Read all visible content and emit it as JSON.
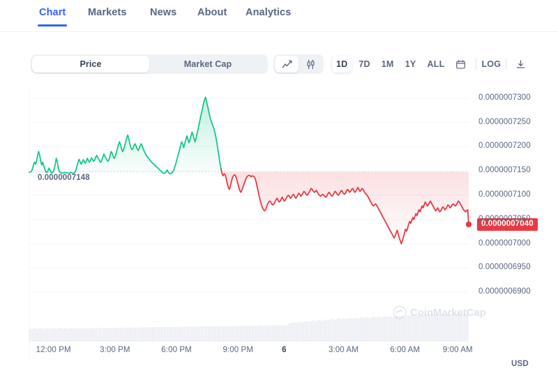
{
  "nav": {
    "tabs": [
      {
        "label": "Chart",
        "active": true
      },
      {
        "label": "Markets",
        "active": false
      },
      {
        "label": "News",
        "active": false
      },
      {
        "label": "About",
        "active": false
      },
      {
        "label": "Analytics",
        "active": false
      }
    ]
  },
  "toolbar": {
    "metric_toggle": [
      {
        "label": "Price",
        "active": true
      },
      {
        "label": "Market Cap",
        "active": false
      }
    ],
    "chart_types": [
      {
        "icon": "line-chart-icon",
        "active": true
      },
      {
        "icon": "candlestick-chart-icon",
        "active": false
      }
    ],
    "ranges": [
      {
        "label": "1D",
        "active": true
      },
      {
        "label": "7D",
        "active": false
      },
      {
        "label": "1M",
        "active": false
      },
      {
        "label": "1Y",
        "active": false
      },
      {
        "label": "ALL",
        "active": false
      }
    ],
    "calendar_icon": "calendar-icon",
    "log_label": "LOG",
    "download_icon": "download-icon"
  },
  "chart_data": {
    "type": "line",
    "title": "",
    "xlabel": "",
    "ylabel": "",
    "currency": "USD",
    "open_price_label": "0.0000007148",
    "open_price": 7.148e-07,
    "current_price_label": "0.0000007040",
    "current_price": 7.04e-07,
    "ylim": [
      6.8875e-07,
      7.3125e-07
    ],
    "y_ticks": [
      "0.0000007300",
      "0.0000007250",
      "0.0000007200",
      "0.0000007150",
      "0.0000007100",
      "0.0000007050",
      "0.0000007000",
      "0.0000006950",
      "0.0000006900"
    ],
    "y_tick_values": [
      7.3e-07,
      7.25e-07,
      7.2e-07,
      7.15e-07,
      7.1e-07,
      7.05e-07,
      7e-07,
      6.95e-07,
      6.9e-07
    ],
    "x_ticks": [
      "12:00 PM",
      "3:00 PM",
      "6:00 PM",
      "9:00 PM",
      "6",
      "3:00 AM",
      "6:00 AM",
      "9:00 AM"
    ],
    "x_tick_positions": [
      0.055,
      0.195,
      0.335,
      0.475,
      0.58,
      0.715,
      0.855,
      0.975
    ],
    "grid": true,
    "legend": false,
    "colors": {
      "up": "#16C784",
      "down": "#EA3943",
      "brand_blue": "#3861FB",
      "axis_text": "#58667E",
      "grid": "#F3F5F8",
      "volume": "#CFD6E4"
    },
    "series": [
      {
        "name": "Price",
        "values": [
          7.1475e-07,
          7.1478e-07,
          7.149e-07,
          7.154e-07,
          7.162e-07,
          7.168e-07,
          7.164e-07,
          7.17e-07,
          7.182e-07,
          7.19e-07,
          7.183e-07,
          7.17e-07,
          7.162e-07,
          7.168e-07,
          7.161e-07,
          7.154e-07,
          7.148e-07,
          7.147e-07,
          7.15e-07,
          7.156e-07,
          7.152e-07,
          7.147e-07,
          7.146e-07,
          7.148e-07,
          7.154e-07,
          7.164e-07,
          7.176e-07,
          7.169e-07,
          7.156e-07,
          7.149e-07,
          7.147e-07,
          7.146e-07,
          7.1455e-07,
          7.1462e-07,
          7.147e-07,
          7.1465e-07,
          7.146e-07,
          7.1455e-07,
          7.145e-07,
          7.1455e-07,
          7.147e-07,
          7.146e-07,
          7.145e-07,
          7.1455e-07,
          7.147e-07,
          7.152e-07,
          7.16e-07,
          7.168e-07,
          7.174e-07,
          7.169e-07,
          7.164e-07,
          7.168e-07,
          7.173e-07,
          7.17e-07,
          7.166e-07,
          7.17e-07,
          7.176e-07,
          7.172e-07,
          7.168e-07,
          7.171e-07,
          7.177e-07,
          7.174e-07,
          7.17e-07,
          7.172e-07,
          7.178e-07,
          7.182e-07,
          7.178e-07,
          7.174e-07,
          7.17e-07,
          7.168e-07,
          7.172e-07,
          7.179e-07,
          7.185e-07,
          7.18e-07,
          7.176e-07,
          7.172e-07,
          7.17e-07,
          7.174e-07,
          7.182e-07,
          7.19e-07,
          7.186e-07,
          7.18e-07,
          7.176e-07,
          7.18e-07,
          7.188e-07,
          7.196e-07,
          7.204e-07,
          7.21e-07,
          7.204e-07,
          7.196e-07,
          7.19e-07,
          7.194e-07,
          7.202e-07,
          7.21e-07,
          7.218e-07,
          7.224e-07,
          7.216e-07,
          7.206e-07,
          7.198e-07,
          7.194e-07,
          7.196e-07,
          7.202e-07,
          7.206e-07,
          7.202e-07,
          7.196e-07,
          7.192e-07,
          7.196e-07,
          7.202e-07,
          7.206e-07,
          7.201e-07,
          7.195e-07,
          7.19e-07,
          7.186e-07,
          7.182e-07,
          7.179e-07,
          7.176e-07,
          7.174e-07,
          7.171e-07,
          7.168e-07,
          7.166e-07,
          7.164e-07,
          7.162e-07,
          7.16e-07,
          7.158e-07,
          7.156e-07,
          7.154e-07,
          7.152e-07,
          7.15e-07,
          7.148e-07,
          7.146e-07,
          7.145e-07,
          7.146e-07,
          7.148e-07,
          7.152e-07,
          7.148e-07,
          7.145e-07,
          7.144e-07,
          7.145e-07,
          7.147e-07,
          7.15e-07,
          7.156e-07,
          7.162e-07,
          7.17e-07,
          7.178e-07,
          7.186e-07,
          7.194e-07,
          7.202e-07,
          7.21e-07,
          7.206e-07,
          7.198e-07,
          7.206e-07,
          7.214e-07,
          7.222e-07,
          7.216e-07,
          7.208e-07,
          7.214e-07,
          7.222e-07,
          7.23e-07,
          7.224e-07,
          7.216e-07,
          7.21e-07,
          7.218e-07,
          7.228e-07,
          7.238e-07,
          7.248e-07,
          7.258e-07,
          7.268e-07,
          7.278e-07,
          7.288e-07,
          7.296e-07,
          7.302e-07,
          7.294e-07,
          7.284e-07,
          7.274e-07,
          7.264e-07,
          7.256e-07,
          7.25e-07,
          7.244e-07,
          7.238e-07,
          7.23e-07,
          7.22e-07,
          7.208e-07,
          7.194e-07,
          7.18e-07,
          7.166e-07,
          7.154e-07,
          7.144e-07,
          7.14e-07,
          7.144e-07,
          7.142e-07,
          7.134e-07,
          7.124e-07,
          7.116e-07,
          7.112e-07,
          7.118e-07,
          7.128e-07,
          7.136e-07,
          7.14e-07,
          7.142e-07,
          7.14e-07,
          7.134e-07,
          7.126e-07,
          7.118e-07,
          7.11e-07,
          7.106e-07,
          7.11e-07,
          7.116e-07,
          7.122e-07,
          7.128e-07,
          7.134e-07,
          7.138e-07,
          7.14e-07,
          7.141e-07,
          7.14e-07,
          7.138e-07,
          7.14e-07,
          7.139e-07,
          7.138e-07,
          7.134e-07,
          7.126e-07,
          7.116e-07,
          7.106e-07,
          7.096e-07,
          7.088e-07,
          7.08e-07,
          7.074e-07,
          7.07e-07,
          7.068e-07,
          7.07e-07,
          7.076e-07,
          7.082e-07,
          7.086e-07,
          7.088e-07,
          7.086e-07,
          7.082e-07,
          7.08e-07,
          7.082e-07,
          7.086e-07,
          7.09e-07,
          7.094e-07,
          7.09e-07,
          7.086e-07,
          7.088e-07,
          7.092e-07,
          7.096e-07,
          7.092e-07,
          7.088e-07,
          7.09e-07,
          7.094e-07,
          7.098e-07,
          7.1e-07,
          7.098e-07,
          7.094e-07,
          7.096e-07,
          7.1e-07,
          7.102e-07,
          7.098e-07,
          7.094e-07,
          7.096e-07,
          7.1e-07,
          7.104e-07,
          7.102e-07,
          7.098e-07,
          7.1e-07,
          7.104e-07,
          7.108e-07,
          7.106e-07,
          7.102e-07,
          7.1e-07,
          7.102e-07,
          7.106e-07,
          7.11e-07,
          7.114e-07,
          7.112e-07,
          7.108e-07,
          7.106e-07,
          7.108e-07,
          7.11e-07,
          7.106e-07,
          7.102e-07,
          7.1e-07,
          7.098e-07,
          7.1e-07,
          7.102e-07,
          7.1e-07,
          7.098e-07,
          7.096e-07,
          7.098e-07,
          7.102e-07,
          7.106e-07,
          7.104e-07,
          7.1e-07,
          7.098e-07,
          7.1e-07,
          7.104e-07,
          7.108e-07,
          7.106e-07,
          7.102e-07,
          7.1e-07,
          7.102e-07,
          7.106e-07,
          7.11e-07,
          7.108e-07,
          7.104e-07,
          7.102e-07,
          7.104e-07,
          7.108e-07,
          7.112e-07,
          7.11e-07,
          7.106e-07,
          7.108e-07,
          7.112e-07,
          7.114e-07,
          7.11e-07,
          7.106e-07,
          7.108e-07,
          7.112e-07,
          7.116e-07,
          7.112e-07,
          7.108e-07,
          7.11e-07,
          7.114e-07,
          7.112e-07,
          7.108e-07,
          7.104e-07,
          7.102e-07,
          7.1e-07,
          7.096e-07,
          7.092e-07,
          7.088e-07,
          7.084e-07,
          7.08e-07,
          7.078e-07,
          7.08e-07,
          7.082e-07,
          7.08e-07,
          7.076e-07,
          7.072e-07,
          7.068e-07,
          7.064e-07,
          7.06e-07,
          7.056e-07,
          7.052e-07,
          7.048e-07,
          7.044e-07,
          7.04e-07,
          7.036e-07,
          7.032e-07,
          7.028e-07,
          7.024e-07,
          7.02e-07,
          7.016e-07,
          7.012e-07,
          7.016e-07,
          7.022e-07,
          7.028e-07,
          7.02e-07,
          7.012e-07,
          7.006e-07,
          7e-07,
          7.006e-07,
          7.014e-07,
          7.022e-07,
          7.03e-07,
          7.026e-07,
          7.032e-07,
          7.04e-07,
          7.046e-07,
          7.042e-07,
          7.048e-07,
          7.054e-07,
          7.05e-07,
          7.056e-07,
          7.062e-07,
          7.058e-07,
          7.064e-07,
          7.07e-07,
          7.066e-07,
          7.072e-07,
          7.078e-07,
          7.074e-07,
          7.08e-07,
          7.086e-07,
          7.082e-07,
          7.078e-07,
          7.08e-07,
          7.084e-07,
          7.088e-07,
          7.084e-07,
          7.08e-07,
          7.076e-07,
          7.072e-07,
          7.068e-07,
          7.07e-07,
          7.074e-07,
          7.07e-07,
          7.066e-07,
          7.068e-07,
          7.072e-07,
          7.076e-07,
          7.074e-07,
          7.07e-07,
          7.072e-07,
          7.076e-07,
          7.08e-07,
          7.078e-07,
          7.074e-07,
          7.076e-07,
          7.08e-07,
          7.082e-07,
          7.08e-07,
          7.078e-07,
          7.08e-07,
          7.084e-07,
          7.088e-07,
          7.086e-07,
          7.082e-07,
          7.078e-07,
          7.074e-07,
          7.07e-07,
          7.068e-07,
          7.066e-07,
          7.068e-07,
          7.07e-07,
          7.04e-07
        ]
      }
    ],
    "volume": {
      "name": "Volume",
      "values": [
        42,
        43,
        41,
        44,
        45,
        43,
        42,
        44,
        46,
        45,
        43,
        42,
        44,
        43,
        45,
        44,
        42,
        43,
        45,
        44,
        43,
        42,
        44,
        46,
        45,
        44,
        43,
        45,
        44,
        43,
        42,
        44,
        45,
        44,
        43,
        45,
        46,
        44,
        43,
        45,
        44,
        43,
        45,
        46,
        44,
        43,
        45,
        47,
        46,
        44,
        43,
        45,
        46,
        45,
        44,
        46,
        47,
        45,
        44,
        46,
        45,
        44,
        46,
        47,
        46,
        45,
        47,
        48,
        46,
        45,
        47,
        46,
        45,
        47,
        48,
        47,
        46,
        48,
        47,
        46,
        48,
        49,
        47,
        46,
        48,
        47,
        46,
        48,
        49,
        48,
        47,
        49,
        48,
        47,
        49,
        50,
        48,
        47,
        49,
        48,
        47,
        49,
        50,
        49,
        48,
        50,
        49,
        48,
        50,
        51,
        49,
        48,
        50,
        49,
        48,
        50,
        51,
        50,
        49,
        51,
        50,
        49,
        51,
        52,
        50,
        49,
        51,
        50,
        49,
        51,
        52,
        51,
        50,
        52,
        51,
        50,
        52,
        53,
        51,
        50,
        52,
        51,
        50,
        52,
        53,
        52,
        51,
        53,
        52,
        51,
        53,
        54,
        52,
        51,
        53,
        52,
        51,
        53,
        54,
        53,
        52,
        54,
        53,
        52,
        54,
        55,
        53,
        52,
        54,
        53,
        52,
        54,
        55,
        54,
        53,
        55,
        54,
        53,
        55,
        56,
        54,
        53,
        55,
        54,
        53,
        55,
        56,
        55,
        54,
        56,
        55,
        54,
        56,
        57,
        55,
        54,
        56,
        55,
        54,
        56,
        60,
        62,
        64,
        66,
        68,
        66,
        64,
        66,
        68,
        70,
        68,
        66,
        68,
        70,
        72,
        70,
        68,
        70,
        72,
        74,
        72,
        70,
        72,
        74,
        76,
        74,
        72,
        74,
        76,
        78,
        76,
        74,
        76,
        78,
        80,
        78,
        76,
        78,
        80,
        82,
        80,
        78,
        80,
        82,
        80,
        78,
        80,
        82,
        84,
        82,
        80,
        82,
        84,
        82,
        80,
        82,
        84,
        86,
        84,
        82,
        84,
        86,
        84,
        82,
        84,
        86,
        88,
        86,
        84,
        86,
        88,
        86,
        84,
        86,
        88,
        90,
        88,
        86,
        88,
        90,
        88,
        86,
        88,
        90,
        92,
        90,
        88,
        90,
        92,
        90,
        88,
        90,
        92,
        94,
        92,
        90,
        92,
        94,
        92,
        90,
        92,
        94,
        96,
        94,
        92,
        94,
        96,
        94,
        92,
        94,
        96,
        98,
        96,
        94,
        96,
        98,
        96,
        94,
        96,
        98,
        96,
        94,
        96,
        98,
        96,
        94,
        96,
        98,
        100,
        98,
        96,
        98,
        100,
        98,
        96,
        98,
        100,
        98,
        96,
        98
      ]
    }
  },
  "watermark": {
    "text": "CoinMarketCap",
    "logo": "coinmarketcap-logo-icon"
  }
}
